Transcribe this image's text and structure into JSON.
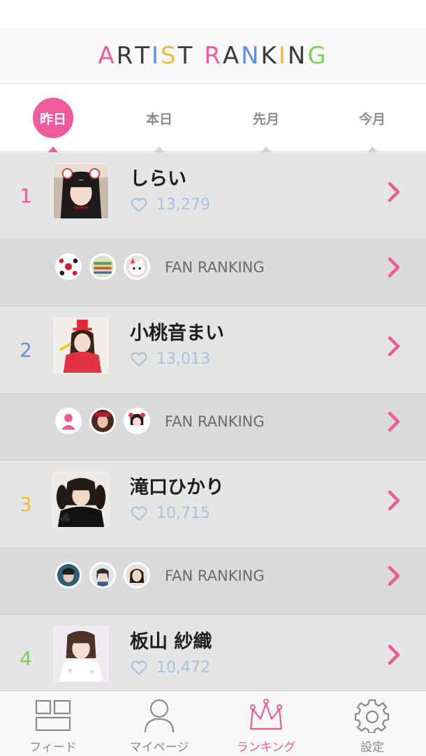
{
  "header": {
    "title_letters": [
      {
        "ch": "A",
        "color": "#ec5b9b"
      },
      {
        "ch": "R",
        "color": "#3a3a3a"
      },
      {
        "ch": "T",
        "color": "#3a3a3a"
      },
      {
        "ch": "I",
        "color": "#5e8ee0"
      },
      {
        "ch": "S",
        "color": "#f2b940"
      },
      {
        "ch": "T",
        "color": "#3a3a3a"
      },
      {
        "ch": " ",
        "color": "#3a3a3a"
      },
      {
        "ch": "R",
        "color": "#ec5b9b"
      },
      {
        "ch": "A",
        "color": "#3a3a3a"
      },
      {
        "ch": "N",
        "color": "#5e8ee0"
      },
      {
        "ch": "K",
        "color": "#3a3a3a"
      },
      {
        "ch": "I",
        "color": "#f2b940"
      },
      {
        "ch": "N",
        "color": "#3a3a3a"
      },
      {
        "ch": "G",
        "color": "#7ccd5c"
      }
    ]
  },
  "tabs": [
    {
      "label": "昨日",
      "active": true
    },
    {
      "label": "本日",
      "active": false
    },
    {
      "label": "先月",
      "active": false
    },
    {
      "label": "今月",
      "active": false
    }
  ],
  "ranking": [
    {
      "rank": "1",
      "rank_color": "#ec5b9b",
      "name": "しらい",
      "likes": "13,279",
      "photo_icon": "artist-photo-bunny-hair",
      "fan_label": "FAN RANKING",
      "fan_icons": [
        "fan-avatar-soccer-ball",
        "fan-avatar-pattern",
        "fan-avatar-cat"
      ]
    },
    {
      "rank": "2",
      "rank_color": "#5e8ee0",
      "name": "小桃音まい",
      "likes": "13,013",
      "photo_icon": "artist-photo-red-hat",
      "fan_label": "FAN RANKING",
      "fan_icons": [
        "fan-avatar-default-user",
        "fan-avatar-photo",
        "fan-avatar-character"
      ]
    },
    {
      "rank": "3",
      "rank_color": "#f2b940",
      "name": "滝口ひかり",
      "likes": "10,715",
      "photo_icon": "artist-photo-twintails",
      "fan_label": "FAN RANKING",
      "fan_icons": [
        "fan-avatar-photo",
        "fan-avatar-photo",
        "fan-avatar-photo"
      ]
    },
    {
      "rank": "4",
      "rank_color": "#7ccd5c",
      "name": "板山 紗織",
      "likes": "10,472",
      "photo_icon": "artist-photo-white-dress"
    }
  ],
  "bottom_nav": [
    {
      "label": "フィード",
      "icon": "feed-icon",
      "active": false
    },
    {
      "label": "マイページ",
      "icon": "user-icon",
      "active": false
    },
    {
      "label": "ランキング",
      "icon": "crown-icon",
      "active": true
    },
    {
      "label": "設定",
      "icon": "gear-icon",
      "active": false
    }
  ],
  "colors": {
    "accent_pink": "#ec5b9b",
    "like_blue": "#a8c2dd"
  }
}
